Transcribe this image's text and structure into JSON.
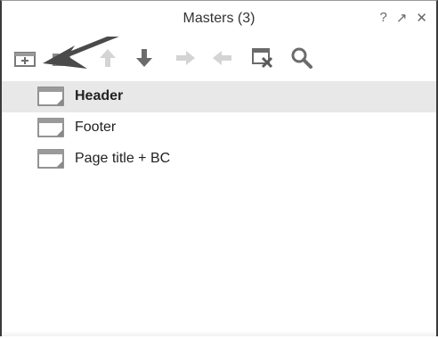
{
  "panel": {
    "title": "Masters (3)",
    "controls": {
      "help": "?",
      "popout": "↗",
      "close": "✕"
    }
  },
  "toolbar": {
    "items": [
      {
        "name": "add-master",
        "icon": "add-master-icon",
        "enabled": true
      },
      {
        "name": "add-folder",
        "icon": "add-folder-icon",
        "enabled": true
      },
      {
        "name": "move-up",
        "icon": "arrow-up-icon",
        "enabled": false
      },
      {
        "name": "move-down",
        "icon": "arrow-down-icon",
        "enabled": true
      },
      {
        "name": "indent",
        "icon": "arrow-right-icon",
        "enabled": false
      },
      {
        "name": "outdent",
        "icon": "arrow-left-icon",
        "enabled": false
      },
      {
        "name": "delete",
        "icon": "delete-master-icon",
        "enabled": true
      },
      {
        "name": "search",
        "icon": "search-icon",
        "enabled": true
      }
    ]
  },
  "masters": {
    "items": [
      {
        "label": "Header",
        "selected": true
      },
      {
        "label": "Footer",
        "selected": false
      },
      {
        "label": "Page title + BC",
        "selected": false
      }
    ]
  },
  "colors": {
    "icon_active": "#6b6b6b",
    "icon_disabled": "#d4d4d4",
    "selection": "#e8e8e8",
    "annotation_arrow": "#4a4a4a"
  }
}
